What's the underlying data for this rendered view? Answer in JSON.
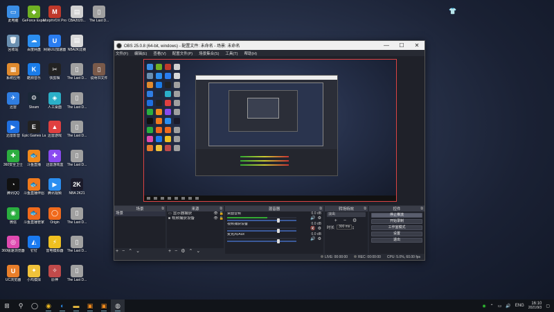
{
  "desktop": {
    "columns": [
      [
        {
          "label": "此电脑",
          "icon": "computer-icon",
          "color": "#3a8ee6",
          "glyph": "▭"
        },
        {
          "label": "回收站",
          "icon": "recycle-bin-icon",
          "color": "#6a8fb0",
          "glyph": "🗑"
        },
        {
          "label": "系统应用",
          "icon": "system-apps-icon",
          "color": "#e08a2e",
          "glyph": "▦"
        },
        {
          "label": "迅雷",
          "icon": "xunlei-icon",
          "color": "#2f7de1",
          "glyph": "✈"
        },
        {
          "label": "迅雷影音",
          "icon": "xunlei-player-icon",
          "color": "#1f6fe0",
          "glyph": "▶"
        },
        {
          "label": "360安全卫士",
          "icon": "360-security-icon",
          "color": "#2cae3f",
          "glyph": "✚"
        },
        {
          "label": "腾讯QQ",
          "icon": "qq-icon",
          "color": "#111111",
          "glyph": "◔"
        },
        {
          "label": "微信",
          "icon": "wechat-icon",
          "color": "#2aae3f",
          "glyph": "◉"
        },
        {
          "label": "360极速浏览器",
          "icon": "360-browser-icon",
          "color": "#e04ab0",
          "glyph": "◎"
        },
        {
          "label": "UC浏览器",
          "icon": "uc-browser-icon",
          "color": "#e87e2a",
          "glyph": "U"
        }
      ],
      [
        {
          "label": "GeForce Experience",
          "icon": "geforce-icon",
          "color": "#6fb023",
          "glyph": "◆"
        },
        {
          "label": "百度网盘",
          "icon": "baidu-netdisk-icon",
          "color": "#2b8ef0",
          "glyph": "☁"
        },
        {
          "label": "酷狗音乐",
          "icon": "kugou-icon",
          "color": "#1a7ce8",
          "glyph": "K"
        },
        {
          "label": "Steam",
          "icon": "steam-icon",
          "color": "#1b2838",
          "glyph": "⚙"
        },
        {
          "label": "Epic Games Launcher",
          "icon": "epic-icon",
          "color": "#222222",
          "glyph": "E"
        },
        {
          "label": "斗鱼直播",
          "icon": "douyu-icon",
          "color": "#f08a1c",
          "glyph": "🐟"
        },
        {
          "label": "斗鱼直播伴侣",
          "icon": "douyu-companion-icon",
          "color": "#f07a1c",
          "glyph": "🐟"
        },
        {
          "label": "斗鱼直播管家",
          "icon": "douyu-manager-icon",
          "color": "#f06a1c",
          "glyph": "🐟"
        },
        {
          "label": "钉钉",
          "icon": "dingtalk-icon",
          "color": "#1a7af0",
          "glyph": "◭"
        },
        {
          "label": "小鸡模拟",
          "icon": "xiaoji-icon",
          "color": "#f0c23a",
          "glyph": "✦"
        }
      ],
      [
        {
          "label": "MorphVOX Pro",
          "icon": "morphvox-icon",
          "color": "#c0392b",
          "glyph": "M"
        },
        {
          "label": "网易UU加速器",
          "icon": "uu-accelerator-icon",
          "color": "#2a7df0",
          "glyph": "U"
        },
        {
          "label": "快剪辑",
          "icon": "kuaijianji-icon",
          "color": "#222222",
          "glyph": "✂"
        },
        {
          "label": "人工桌面",
          "icon": "wallpaper-icon",
          "color": "#2bb0c8",
          "glyph": "◈"
        },
        {
          "label": "迅雷游戏",
          "icon": "xunlei-game-icon",
          "color": "#e04040",
          "glyph": "▲"
        },
        {
          "label": "迅雷游戏盒",
          "icon": "game-box-icon",
          "color": "#8a4af0",
          "glyph": "✚"
        },
        {
          "label": "腾讯视频",
          "icon": "tencent-video-icon",
          "color": "#2b8ef0",
          "glyph": "▶"
        },
        {
          "label": "Origin",
          "icon": "origin-icon",
          "color": "#f06a1c",
          "glyph": "◯"
        },
        {
          "label": "雷电模拟器",
          "icon": "ldplayer-icon",
          "color": "#f0c020",
          "glyph": "⚡"
        },
        {
          "label": "原神",
          "icon": "genshin-icon",
          "color": "#c04a4a",
          "glyph": "✧"
        }
      ],
      [
        {
          "label": "CBA2020...",
          "icon": "cba-icon",
          "color": "#d0d0d0",
          "glyph": "▤"
        },
        {
          "label": "NBA2K比赛",
          "icon": "nba2k-folder-icon",
          "color": "#d8d8d8",
          "glyph": "▤"
        },
        {
          "label": "The Last D...",
          "icon": "file-icon",
          "color": "#a0a0a0",
          "glyph": "▯"
        },
        {
          "label": "The Last D...",
          "icon": "file-icon",
          "color": "#a0a0a0",
          "glyph": "▯"
        },
        {
          "label": "The Last D...",
          "icon": "file-icon",
          "color": "#a0a0a0",
          "glyph": "▯"
        },
        {
          "label": "The Last D...",
          "icon": "file-icon",
          "color": "#a0a0a0",
          "glyph": "▯"
        },
        {
          "label": "NBA 2K21",
          "icon": "nba2k21-icon",
          "color": "#1a1a2a",
          "glyph": "2K"
        },
        {
          "label": "The Last D...",
          "icon": "file-icon",
          "color": "#a0a0a0",
          "glyph": "▯"
        },
        {
          "label": "The Last D...",
          "icon": "file-icon",
          "color": "#a0a0a0",
          "glyph": "▯"
        },
        {
          "label": "The Last D...",
          "icon": "file-icon",
          "color": "#a0a0a0",
          "glyph": "▯"
        }
      ],
      [
        {
          "label": "The Last D...",
          "icon": "file-icon",
          "color": "#a0a0a0",
          "glyph": "▯"
        },
        {
          "label": "",
          "icon": "blank-icon",
          "color": "transparent",
          "glyph": ""
        },
        {
          "label": "说明书文件",
          "icon": "document-icon",
          "color": "#7a5a4a",
          "glyph": "▯"
        }
      ]
    ]
  },
  "obs": {
    "title": "OBS 25.0.8 (64-bit, windows) - 配置文件: 未命名 - 场景: 未命名",
    "menu": [
      "文件(F)",
      "编辑(E)",
      "查看(V)",
      "配置文件(P)",
      "场景集合(S)",
      "工具(T)",
      "帮助(H)"
    ],
    "docks": {
      "scenes": {
        "title": "场景",
        "items": [
          "场景"
        ]
      },
      "sources": {
        "title": "来源",
        "items": [
          {
            "name": "显示器捕获",
            "icon": "monitor-icon"
          },
          {
            "name": "视频捕获设备",
            "icon": "camera-icon"
          }
        ]
      },
      "mixer": {
        "title": "混音器",
        "channels": [
          {
            "name": "桌面音频",
            "db": "0.0 dB",
            "level": 0.58,
            "fader": 0.72,
            "muted": false
          },
          {
            "name": "视频捕获设备",
            "db": "0.0 dB",
            "level": 0.0,
            "fader": 0.72,
            "muted": true
          },
          {
            "name": "麦克风/Aux",
            "db": "0.0 dB",
            "level": 0.0,
            "fader": 0.72,
            "muted": false
          }
        ]
      },
      "transitions": {
        "title": "转场特效",
        "type": "淡出",
        "duration_label": "时长",
        "duration": "300 ms"
      },
      "controls": {
        "title": "控件",
        "buttons": [
          "停止推流",
          "开始录制",
          "工作室模式",
          "设置",
          "退出"
        ]
      }
    },
    "status": {
      "live": "LIVE: 00:00:00",
      "rec": "REC: 00:00:00",
      "cpu": "CPU: 5.0%, 60.00 fps"
    }
  },
  "taskbar": {
    "apps": [
      "windows-start-icon",
      "search-icon",
      "task-view-icon",
      "chrome-icon",
      "edge-icon",
      "file-explorer-icon",
      "douyu-icon",
      "douyu-companion-icon",
      "obs-icon"
    ],
    "tray": {
      "lang": "ENG",
      "time": "16:10",
      "date": "2021/9/3"
    }
  },
  "colors": {
    "accent": "#d44",
    "obs_bg": "#2b2e38",
    "meter_green": "#3a3"
  }
}
